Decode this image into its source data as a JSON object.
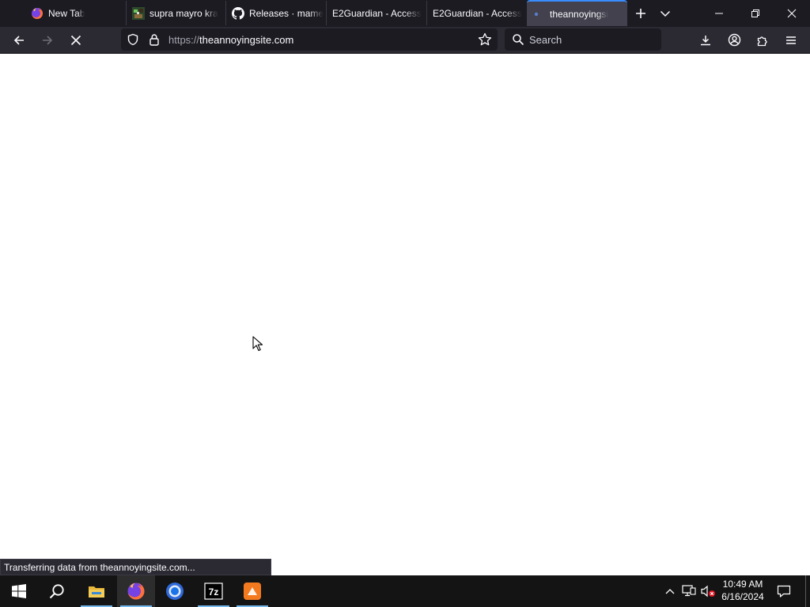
{
  "tabs": [
    {
      "title": "New Tab",
      "icon": "firefox-icon"
    },
    {
      "title": "supra mayro kra",
      "icon": "game-favicon-icon"
    },
    {
      "title": "Releases · mame",
      "icon": "github-icon"
    },
    {
      "title": "E2Guardian - Access",
      "icon": "none"
    },
    {
      "title": "E2Guardian - Access",
      "icon": "none"
    },
    {
      "title": "theannoyingsi",
      "icon": "loading-dot-icon",
      "active": true
    }
  ],
  "url": {
    "protocol": "https://",
    "host": "theannoyingsite.com"
  },
  "search": {
    "placeholder": "Search"
  },
  "status_text": "Transferring data from theannoyingsite.com...",
  "clock": {
    "time": "10:49 AM",
    "date": "6/16/2024"
  },
  "taskbar": [
    "windows-start-icon",
    "search-icon",
    "file-explorer-icon",
    "firefox-icon",
    "chrome-icon",
    "7zip-icon",
    "app-icon"
  ],
  "colors": {
    "tab_active_accent": "#3a8dff",
    "taskbar_active": "#76b9ed"
  }
}
